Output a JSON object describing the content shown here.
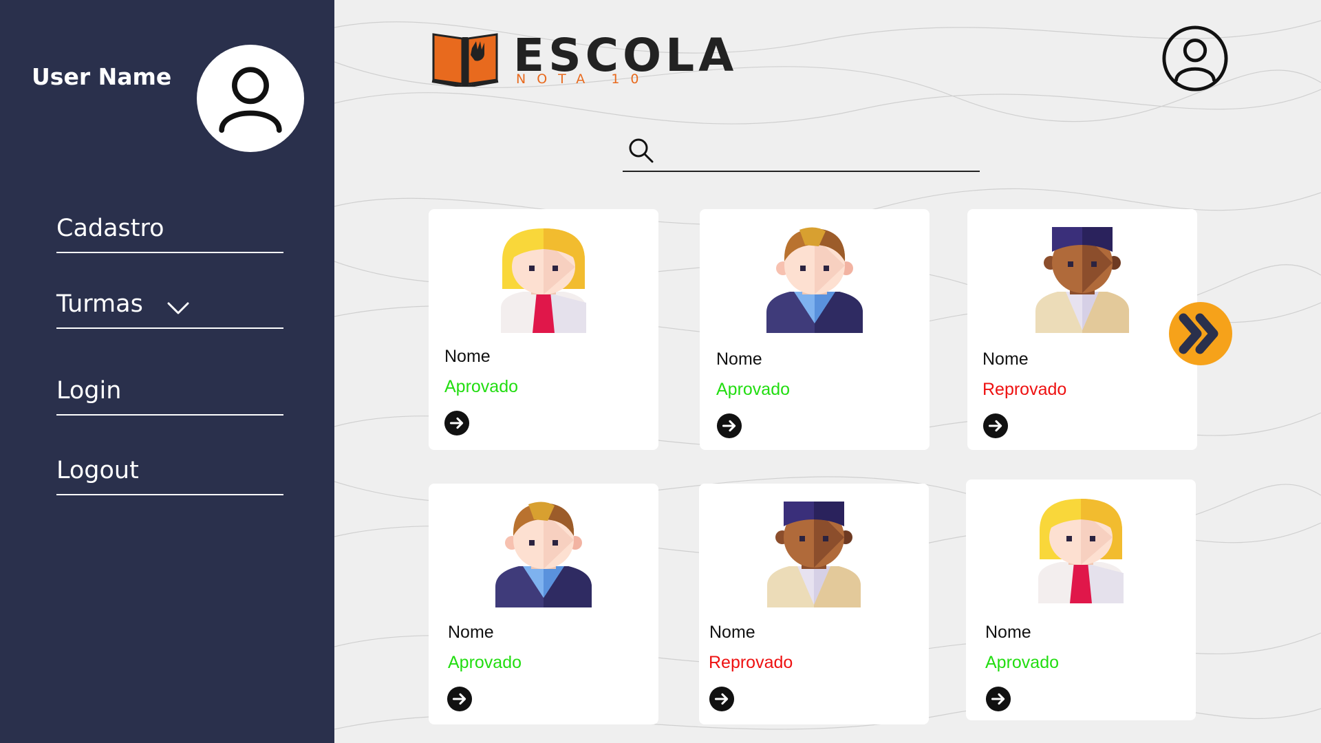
{
  "sidebar": {
    "user_name": "User Name",
    "avatar_icon": "user-icon",
    "items": [
      {
        "label": "Cadastro"
      },
      {
        "label": "Turmas",
        "icon": "chevron-down-icon"
      },
      {
        "label": "Login"
      },
      {
        "label": "Logout"
      }
    ]
  },
  "header": {
    "logo_title": "ESCOLA",
    "logo_subtitle": "NOTA 10",
    "profile_icon": "user-icon"
  },
  "search": {
    "value": "",
    "placeholder": ""
  },
  "colors": {
    "sidebar_bg": "#2a304c",
    "approved": "#22dd11",
    "failed": "#ee1111",
    "accent_orange": "#f6a21a",
    "logo_orange": "#e86a1e"
  },
  "students": [
    {
      "name": "Nome",
      "status": "Aprovado",
      "avatar": "girl-blonde-avatar"
    },
    {
      "name": "Nome",
      "status": "Aprovado",
      "avatar": "boy-brown-hair-avatar"
    },
    {
      "name": "Nome",
      "status": "Reprovado",
      "avatar": "boy-dark-skin-avatar"
    },
    {
      "name": "Nome",
      "status": "Aprovado",
      "avatar": "boy-brown-hair-avatar"
    },
    {
      "name": "Nome",
      "status": "Reprovado",
      "avatar": "boy-dark-skin-avatar"
    },
    {
      "name": "Nome",
      "status": "Aprovado",
      "avatar": "girl-blonde-avatar"
    }
  ],
  "pagination": {
    "next_icon": "double-chevron-right-icon"
  }
}
